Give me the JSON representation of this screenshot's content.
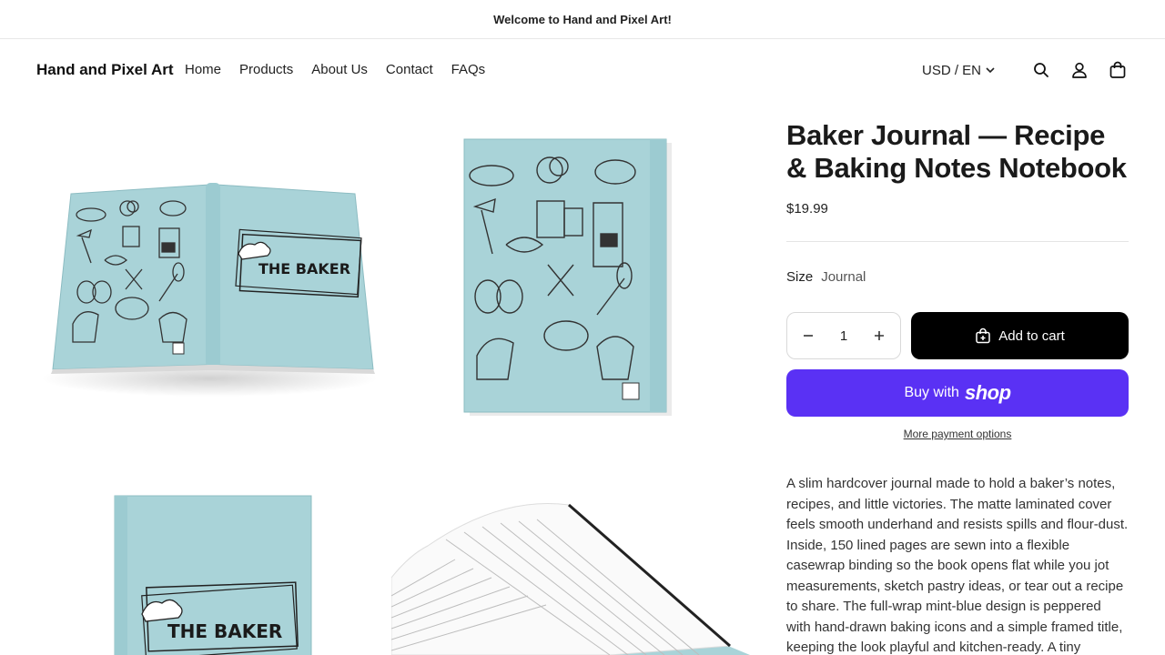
{
  "announcement": {
    "text": "Welcome to Hand and Pixel Art!"
  },
  "header": {
    "logo": "Hand and Pixel Art",
    "nav": [
      {
        "label": "Home"
      },
      {
        "label": "Products"
      },
      {
        "label": "About Us"
      },
      {
        "label": "Contact"
      },
      {
        "label": "FAQs"
      }
    ],
    "locale": "USD / EN",
    "icons": [
      "search-icon",
      "account-icon",
      "cart-bag-icon"
    ]
  },
  "gallery": {
    "images": [
      {
        "name": "open-journal-spread",
        "cover_title": "THE BAKER"
      },
      {
        "name": "journal-back-cover"
      },
      {
        "name": "journal-front-cover",
        "cover_title": "THE BAKER"
      },
      {
        "name": "journal-open-lined-pages"
      }
    ],
    "cover_color": "#a9d3d8"
  },
  "product": {
    "title": "Baker Journal — Recipe & Baking Notes Notebook",
    "price": "$19.99",
    "size_label": "Size",
    "size_value": "Journal",
    "quantity": "1",
    "add_to_cart": "Add to cart",
    "buy_with": "Buy with",
    "shop_brand": "shop",
    "more_payment": "More payment options",
    "description": "A slim hardcover journal made to hold a baker’s notes, recipes, and little victories. The matte laminated cover feels smooth underhand and resists spills and flour-dust. Inside, 150 lined pages are sewn into a flexible casewrap binding so the book opens flat while you jot measurements, sketch pastry ideas, or tear out a recipe to share. The full-wrap mint-blue design is peppered with hand-drawn baking icons and a simple framed title, keeping the look playful and kitchen-ready. A tiny"
  },
  "colors": {
    "accent_shop": "#5a31f4",
    "button_dark": "#000000",
    "cover": "#a9d3d8"
  }
}
